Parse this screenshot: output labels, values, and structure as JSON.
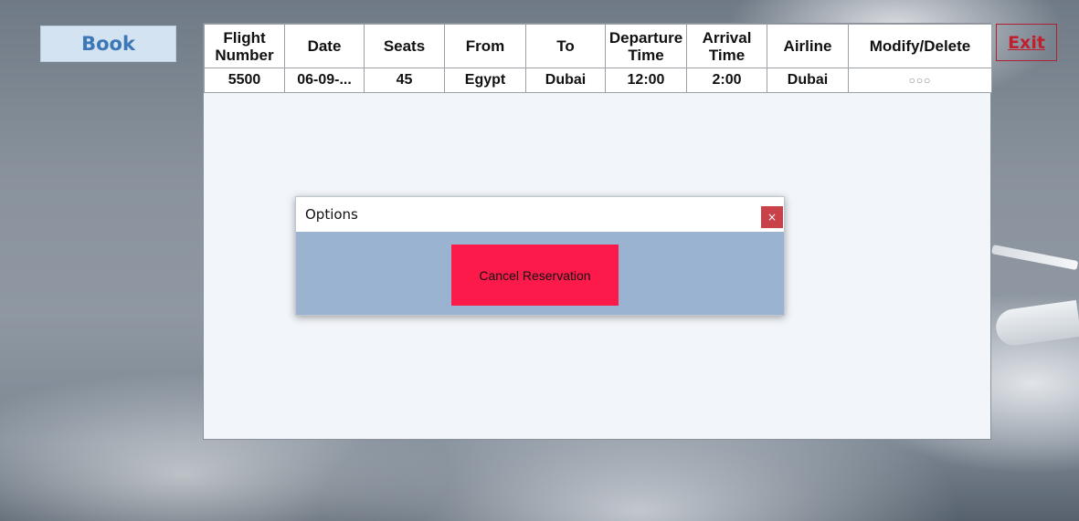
{
  "book_button": {
    "label": "Book"
  },
  "exit_button": {
    "label": "Exit"
  },
  "table": {
    "headers": {
      "flight_number": "Flight Number",
      "date": "Date",
      "seats": "Seats",
      "from": "From",
      "to": "To",
      "departure": "Departure Time",
      "arrival": "Arrival Time",
      "airline": "Airline",
      "modify_delete": "Modify/Delete"
    },
    "rows": [
      {
        "flight_number": "5500",
        "date": "06-09-...",
        "seats": "45",
        "from": "Egypt",
        "to": "Dubai",
        "departure": "12:00",
        "arrival": "2:00",
        "airline": "Dubai",
        "modify_delete": "○○○"
      }
    ]
  },
  "dialog": {
    "title": "Options",
    "close_label": "×",
    "cancel_button": "Cancel Reservation"
  },
  "icons": {
    "close": "close-icon",
    "more": "ellipsis-icon"
  },
  "colors": {
    "book_bg": "#d3e3f2",
    "book_text": "#3d78b6",
    "exit_text": "#c01f2e",
    "dialog_body": "#9ab3d1",
    "cancel_bg": "#fc1a4b",
    "close_bg": "#c9424a"
  }
}
